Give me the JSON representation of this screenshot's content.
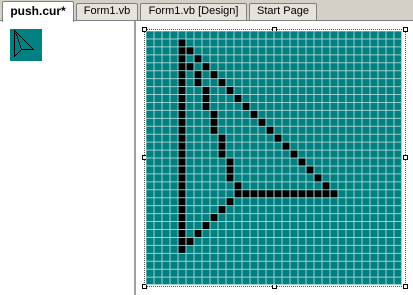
{
  "tabs": [
    {
      "label": "push.cur*",
      "active": true
    },
    {
      "label": "Form1.vb",
      "active": false
    },
    {
      "label": "Form1.vb [Design]",
      "active": false
    },
    {
      "label": "Start Page",
      "active": false
    }
  ],
  "colors": {
    "canvas_fill": "#008080",
    "grid_line": "#9fcfcf",
    "pixel": "#000000"
  },
  "cursor_bitmap": {
    "width": 32,
    "height": 32,
    "pixels": [
      [
        4,
        1
      ],
      [
        4,
        2
      ],
      [
        5,
        2
      ],
      [
        4,
        3
      ],
      [
        6,
        3
      ],
      [
        4,
        4
      ],
      [
        5,
        4
      ],
      [
        7,
        4
      ],
      [
        4,
        5
      ],
      [
        6,
        5
      ],
      [
        8,
        5
      ],
      [
        4,
        6
      ],
      [
        6,
        6
      ],
      [
        9,
        6
      ],
      [
        4,
        7
      ],
      [
        7,
        7
      ],
      [
        10,
        7
      ],
      [
        4,
        8
      ],
      [
        7,
        8
      ],
      [
        11,
        8
      ],
      [
        4,
        9
      ],
      [
        7,
        9
      ],
      [
        12,
        9
      ],
      [
        4,
        10
      ],
      [
        8,
        10
      ],
      [
        13,
        10
      ],
      [
        4,
        11
      ],
      [
        8,
        11
      ],
      [
        14,
        11
      ],
      [
        4,
        12
      ],
      [
        8,
        12
      ],
      [
        15,
        12
      ],
      [
        4,
        13
      ],
      [
        9,
        13
      ],
      [
        16,
        13
      ],
      [
        4,
        14
      ],
      [
        9,
        14
      ],
      [
        17,
        14
      ],
      [
        4,
        15
      ],
      [
        9,
        15
      ],
      [
        18,
        15
      ],
      [
        4,
        16
      ],
      [
        10,
        16
      ],
      [
        19,
        16
      ],
      [
        4,
        17
      ],
      [
        10,
        17
      ],
      [
        20,
        17
      ],
      [
        4,
        18
      ],
      [
        10,
        18
      ],
      [
        21,
        18
      ],
      [
        4,
        19
      ],
      [
        11,
        19
      ],
      [
        22,
        19
      ],
      [
        4,
        20
      ],
      [
        11,
        20
      ],
      [
        12,
        20
      ],
      [
        13,
        20
      ],
      [
        14,
        20
      ],
      [
        15,
        20
      ],
      [
        16,
        20
      ],
      [
        17,
        20
      ],
      [
        18,
        20
      ],
      [
        19,
        20
      ],
      [
        20,
        20
      ],
      [
        21,
        20
      ],
      [
        22,
        20
      ],
      [
        23,
        20
      ],
      [
        4,
        21
      ],
      [
        10,
        21
      ],
      [
        4,
        22
      ],
      [
        9,
        22
      ],
      [
        4,
        23
      ],
      [
        8,
        23
      ],
      [
        4,
        24
      ],
      [
        7,
        24
      ],
      [
        4,
        25
      ],
      [
        6,
        25
      ],
      [
        4,
        26
      ],
      [
        5,
        26
      ],
      [
        4,
        27
      ]
    ]
  }
}
